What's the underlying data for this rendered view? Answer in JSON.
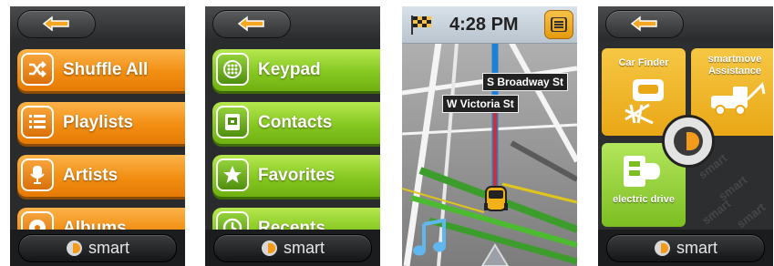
{
  "panels": {
    "music": {
      "items": [
        {
          "label": "Shuffle All",
          "icon": "shuffle-icon"
        },
        {
          "label": "Playlists",
          "icon": "list-icon"
        },
        {
          "label": "Artists",
          "icon": "microphone-icon"
        },
        {
          "label": "Albums",
          "icon": "disc-icon"
        }
      ],
      "brand": "smart"
    },
    "phone": {
      "items": [
        {
          "label": "Keypad",
          "icon": "dialpad-icon"
        },
        {
          "label": "Contacts",
          "icon": "phone-book-icon"
        },
        {
          "label": "Favorites",
          "icon": "star-icon"
        },
        {
          "label": "Recents",
          "icon": "clock-icon"
        }
      ],
      "brand": "smart"
    },
    "navigation": {
      "time": "4:28 PM",
      "streets": [
        "S Broadway St",
        "W Victoria St"
      ],
      "icons": [
        "checkered-flag-icon",
        "menu-icon",
        "music-note-icon",
        "car-icon"
      ]
    },
    "smart_menu": {
      "tiles": [
        {
          "title": "Car Finder",
          "color": "#f3b62b"
        },
        {
          "title": "smartmove Assistance",
          "color": "#f3b62b"
        },
        {
          "title": "electric drive",
          "color": "#8ecf3a"
        }
      ],
      "watermark": "smart",
      "brand": "smart"
    }
  },
  "colors": {
    "orange": "#f28e12",
    "green": "#86c821",
    "dark": "#2a2b2c",
    "map_route": "#1e7fd6"
  }
}
